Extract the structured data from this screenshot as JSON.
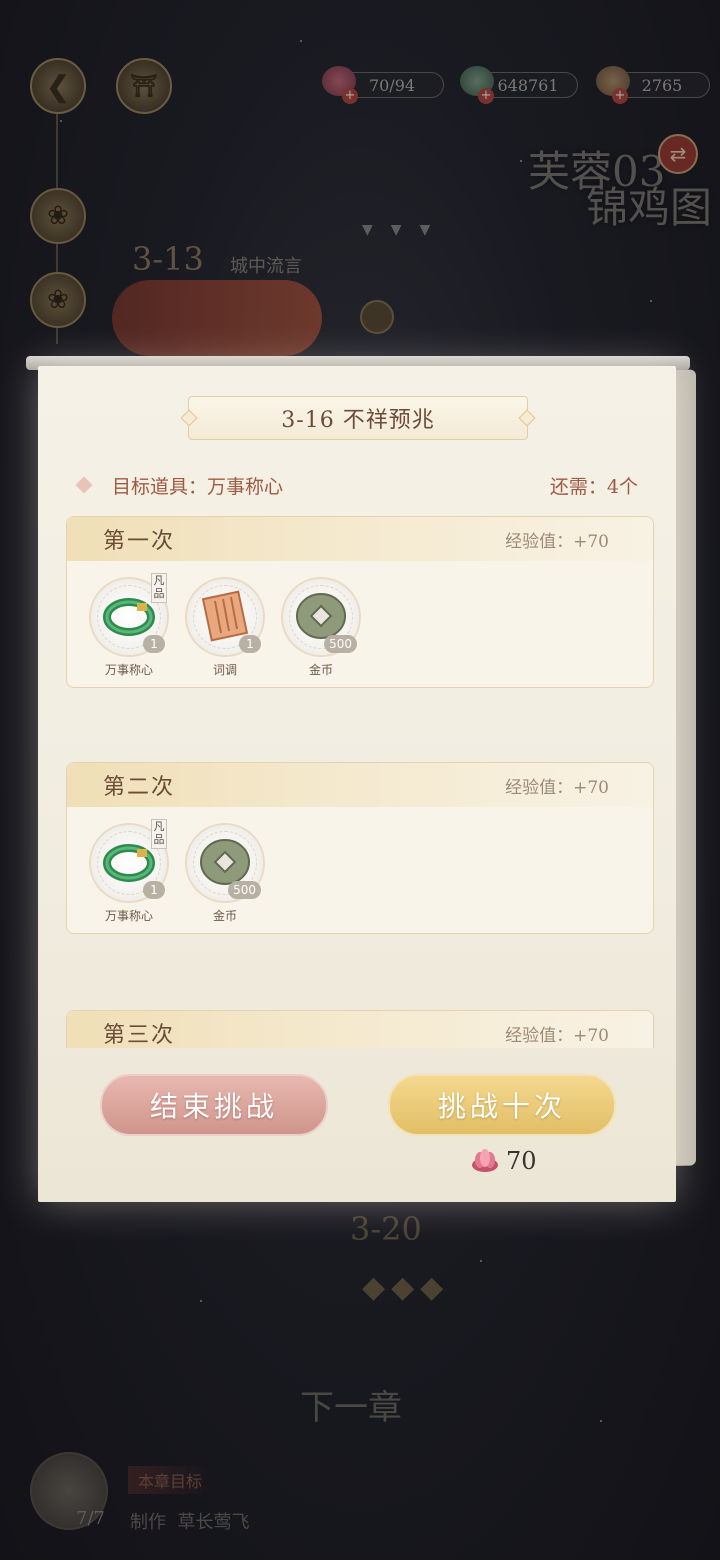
{
  "top_bar": {
    "resources": [
      {
        "name": "lotus",
        "value": "70/94"
      },
      {
        "name": "jade",
        "value": "648761"
      },
      {
        "name": "pouch",
        "value": "2765"
      }
    ]
  },
  "chapter": {
    "title_line1": "芙蓉03",
    "title_line2": "锦鸡图"
  },
  "map": {
    "stage_number": "3-13",
    "stage_name": "城中流言",
    "next_stage_number": "3-20",
    "next_chapter_label": "下一章",
    "goal_label": "本章目标",
    "goal_progress": "7/7",
    "goal_text": "制作  草长莺飞"
  },
  "modal": {
    "title": "3-16 不祥预兆",
    "target_item": "目标道具：万事称心",
    "still_needed": "还需：4个",
    "rounds": [
      {
        "title": "第一次",
        "exp": "经验值：+70",
        "items": [
          {
            "name": "万事称心",
            "count": "1",
            "grade": "凡品",
            "icon": "jade-bracelet-icon"
          },
          {
            "name": "词调",
            "count": "1",
            "grade": "",
            "icon": "scroll-icon"
          },
          {
            "name": "金币",
            "count": "500",
            "grade": "",
            "icon": "coin-icon"
          }
        ]
      },
      {
        "title": "第二次",
        "exp": "经验值：+70",
        "items": [
          {
            "name": "万事称心",
            "count": "1",
            "grade": "凡品",
            "icon": "jade-bracelet-icon"
          },
          {
            "name": "金币",
            "count": "500",
            "grade": "",
            "icon": "coin-icon"
          }
        ]
      },
      {
        "title": "第三次",
        "exp": "经验值：+70",
        "items": []
      }
    ],
    "end_button": "结束挑战",
    "ten_button": "挑战十次",
    "cost": "70"
  },
  "colors": {
    "accent_gold": "#e2bf66",
    "accent_pink": "#cf958c",
    "title_brown": "#6b4c36",
    "target_red": "#a05a44"
  }
}
